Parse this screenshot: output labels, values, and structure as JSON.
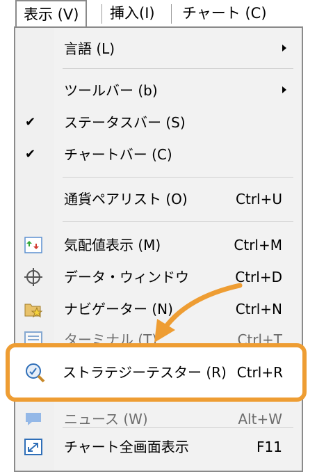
{
  "menubar": {
    "view": "表示 (V)",
    "insert": "挿入(I)",
    "chart": "チャート (C)"
  },
  "menu": {
    "language": {
      "label": "言語 (L)"
    },
    "toolbar": {
      "label": "ツールバー (b)"
    },
    "statusbar": {
      "label": "ステータスバー (S)",
      "checked": true
    },
    "chartbar": {
      "label": "チャートバー (C)",
      "checked": true
    },
    "symbols": {
      "label": "通貨ペアリスト (O)",
      "shortcut": "Ctrl+U"
    },
    "market_watch": {
      "label": "気配値表示 (M)",
      "shortcut": "Ctrl+M"
    },
    "data_window": {
      "label": "データ・ウィンドウ",
      "shortcut": "Ctrl+D"
    },
    "navigator": {
      "label": "ナビゲーター (N)",
      "shortcut": "Ctrl+N"
    },
    "terminal": {
      "label": "ターミナル (T)",
      "shortcut": "Ctrl+T"
    },
    "strategy_tester": {
      "label": "ストラテジーテスター (R)",
      "shortcut": "Ctrl+R"
    },
    "news": {
      "label": "ニュース (W)",
      "shortcut": "Alt+W"
    },
    "fullscreen": {
      "label": "チャート全画面表示",
      "shortcut": "F11"
    }
  },
  "colors": {
    "highlight": "#ee9d33",
    "accent": "#2f6fb8"
  }
}
